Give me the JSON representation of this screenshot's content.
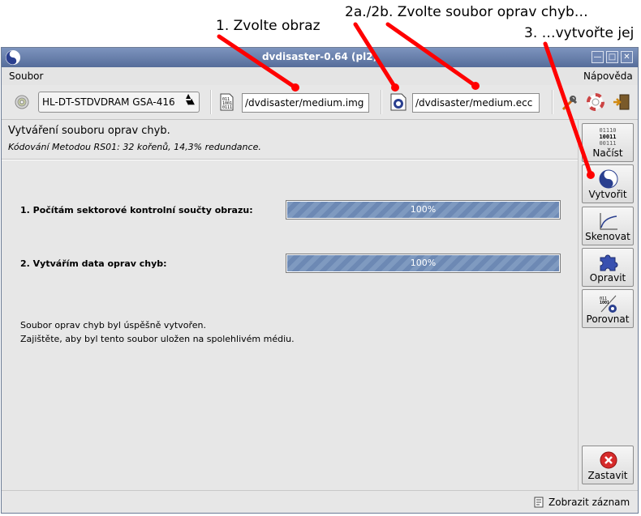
{
  "annotations": {
    "step1": "1. Zvolte obraz",
    "step2": "2a./2b. Zvolte soubor oprav chyb…",
    "step3": "3. …vytvořte jej",
    "arrow_color": "#ff0000"
  },
  "window": {
    "title": "dvdisaster-0.64 (pl2)",
    "controls": [
      "minimize-icon",
      "maximize-icon",
      "close-icon"
    ]
  },
  "menubar": {
    "file": "Soubor",
    "help": "Nápověda"
  },
  "toolbar": {
    "drive": "HL-DT-STDVDRAM GSA-416",
    "image_file": "/dvdisaster/medium.img",
    "ecc_file": "/dvdisaster/medium.ecc"
  },
  "main": {
    "heading": "Vytváření souboru oprav chyb.",
    "subheading": "Kódování Metodou RS01: 32 kořenů, 14,3% redundance.",
    "steps": [
      {
        "label": "1. Počítám sektorové kontrolní součty obrazu:",
        "progress": 100,
        "text": "100%"
      },
      {
        "label": "2. Vytvářím data oprav chyb:",
        "progress": 100,
        "text": "100%"
      }
    ],
    "message_line1": "Soubor oprav chyb byl úspěšně vytvořen.",
    "message_line2": "Zajištěte, aby byl tento soubor uložen na spolehlivém médiu."
  },
  "sidebar": {
    "read": "Načíst",
    "create": "Vytvořit",
    "scan": "Skenovat",
    "fix": "Opravit",
    "compare": "Porovnat",
    "stop": "Zastavit",
    "read_icon_digits": [
      "01110",
      "10011",
      "00111"
    ]
  },
  "statusbar": {
    "log": "Zobrazit záznam"
  },
  "colors": {
    "titlebar": "#6a80ad",
    "progress_fill": "#7791bb",
    "stop_red": "#d62b2b"
  }
}
